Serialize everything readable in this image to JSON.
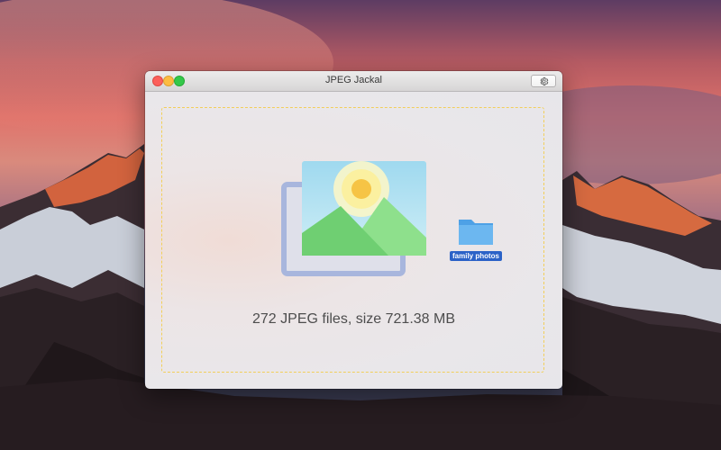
{
  "window": {
    "title": "JPEG Jackal",
    "settings_icon": "gear-icon"
  },
  "drop_area": {
    "icon": "image-placeholder-icon",
    "folder_icon": "folder-icon",
    "folder_name": "family photos",
    "file_info": "272 JPEG files, size 721.38 MB"
  },
  "colors": {
    "dropzone_border": "#f2cf5a",
    "folder_label_bg": "#2b62c7",
    "close": "#fc605b",
    "minimize": "#fdbc40",
    "maximize": "#34c84a"
  }
}
